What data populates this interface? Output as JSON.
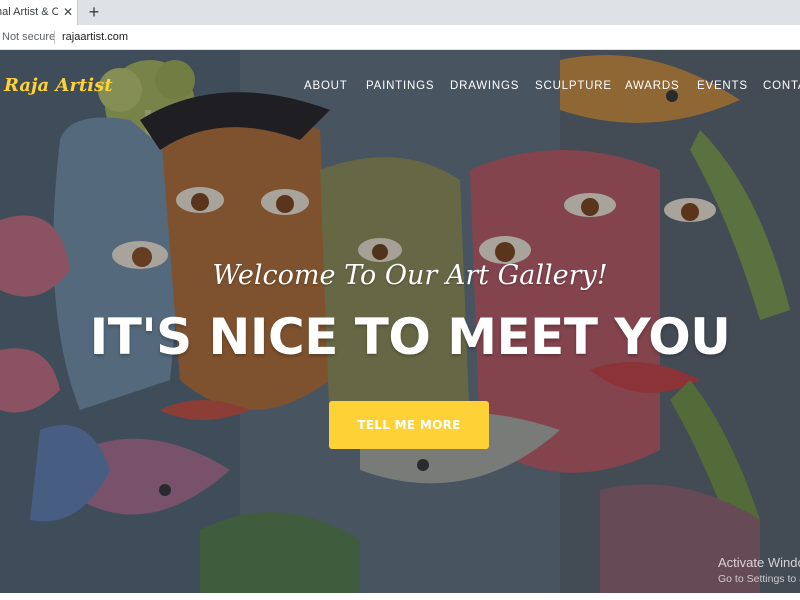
{
  "browser": {
    "tab_title": "nal Artist & Cre",
    "close_glyph": "✕",
    "newtab_glyph": "+",
    "security_label": "Not secure",
    "url": "rajaartist.com"
  },
  "site": {
    "brand": "Raja Artist",
    "nav": [
      "ABOUT",
      "PAINTINGS",
      "DRAWINGS",
      "SCULPTURE",
      "AWARDS",
      "EVENTS",
      "CONTA"
    ]
  },
  "hero": {
    "welcome": "Welcome To Our Art Gallery!",
    "headline": "IT'S NICE TO MEET YOU",
    "cta_label": "TELL ME MORE"
  },
  "os_watermark": {
    "line1": "Activate Windows",
    "line2": "Go to Settings to activate Windows."
  },
  "colors": {
    "accent": "#fed136",
    "tabbar": "#dee1e6"
  }
}
